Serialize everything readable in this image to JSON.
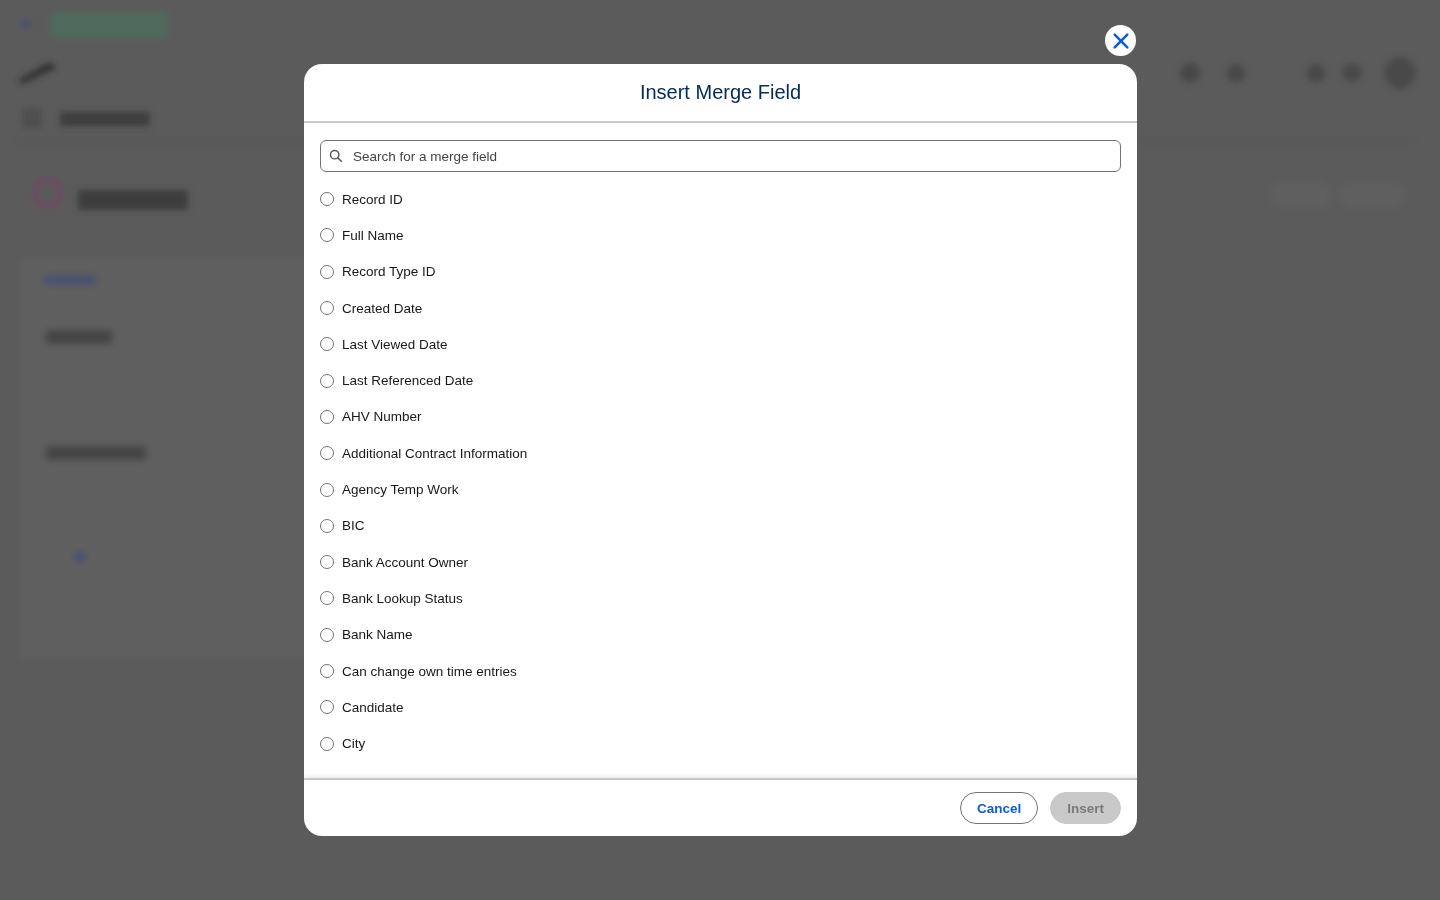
{
  "modal": {
    "title": "Insert Merge Field",
    "search": {
      "placeholder": "Search for a merge field"
    },
    "fields": [
      {
        "label": "Record ID",
        "selected": false
      },
      {
        "label": "Full Name",
        "selected": false
      },
      {
        "label": "Record Type ID",
        "selected": false
      },
      {
        "label": "Created Date",
        "selected": false
      },
      {
        "label": "Last Viewed Date",
        "selected": false
      },
      {
        "label": "Last Referenced Date",
        "selected": false
      },
      {
        "label": "AHV Number",
        "selected": false
      },
      {
        "label": "Additional Contract Information",
        "selected": false
      },
      {
        "label": "Agency Temp Work",
        "selected": false
      },
      {
        "label": "BIC",
        "selected": false
      },
      {
        "label": "Bank Account Owner",
        "selected": false
      },
      {
        "label": "Bank Lookup Status",
        "selected": false
      },
      {
        "label": "Bank Name",
        "selected": false
      },
      {
        "label": "Can change own time entries",
        "selected": false
      },
      {
        "label": "Candidate",
        "selected": false
      },
      {
        "label": "City",
        "selected": false
      }
    ],
    "buttons": [
      {
        "label": "Cancel",
        "disabled": false,
        "kind": "neutral"
      },
      {
        "label": "Insert",
        "disabled": true,
        "kind": "brand"
      }
    ]
  }
}
